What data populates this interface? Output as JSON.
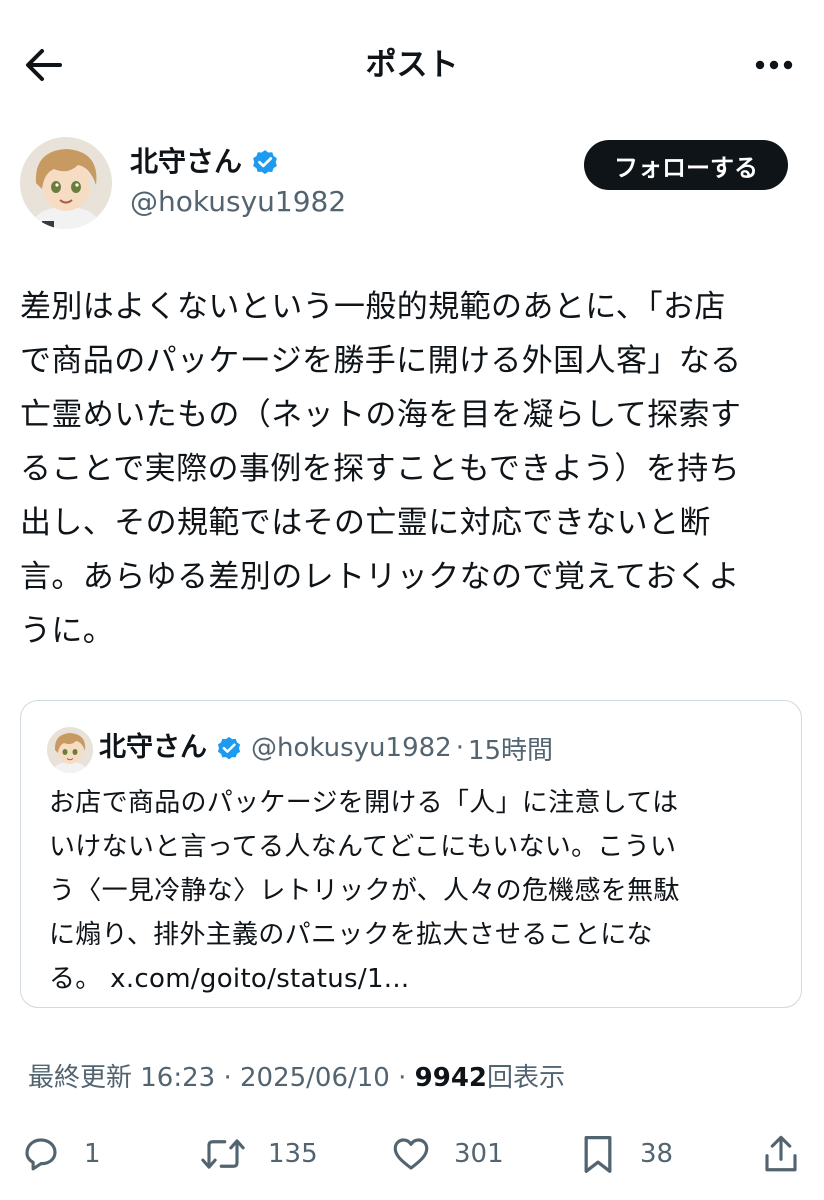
{
  "header": {
    "title": "ポスト",
    "back_icon": "arrow-left-icon",
    "more_icon": "more-horizontal-icon"
  },
  "author": {
    "name": "北守さん",
    "handle": "@hokusyu1982",
    "verified": true,
    "follow_label": "フォローする"
  },
  "post": {
    "text": "差別はよくないという一般的規範のあとに、「お店\nで商品のパッケージを勝手に開ける外国人客」なる\n亡霊めいたもの（ネットの海を目を凝らして探索す\nることで実際の事例を探すこともできよう）を持ち\n出し、その規範ではその亡霊に対応できないと断\n言。あらゆる差別のレトリックなので覚えておくよ\nうに。"
  },
  "quote": {
    "name": "北守さん",
    "handle": "@hokusyu1982",
    "separator": "·",
    "time": "15時間",
    "text": "お店で商品のパッケージを開ける「人」に注意しては\nいけないと言ってる人なんてどこにもいない。こうい\nう〈一見冷静な〉レトリックが、人々の危機感を無駄\nに煽り、排外主義のパニックを拡大させることにな\nる。 x.com/goito/status/1..."
  },
  "meta": {
    "updated": "最終更新 16:23 · 2025/06/10 · ",
    "views_count": "9942",
    "views_label": "回表示"
  },
  "actions": {
    "reply_count": "1",
    "repost_count": "135",
    "like_count": "301",
    "bookmark_count": "38"
  },
  "colors": {
    "text": "#0f1419",
    "secondary": "#536471",
    "verified": "#1d9bf0",
    "border": "#cfd9de"
  }
}
